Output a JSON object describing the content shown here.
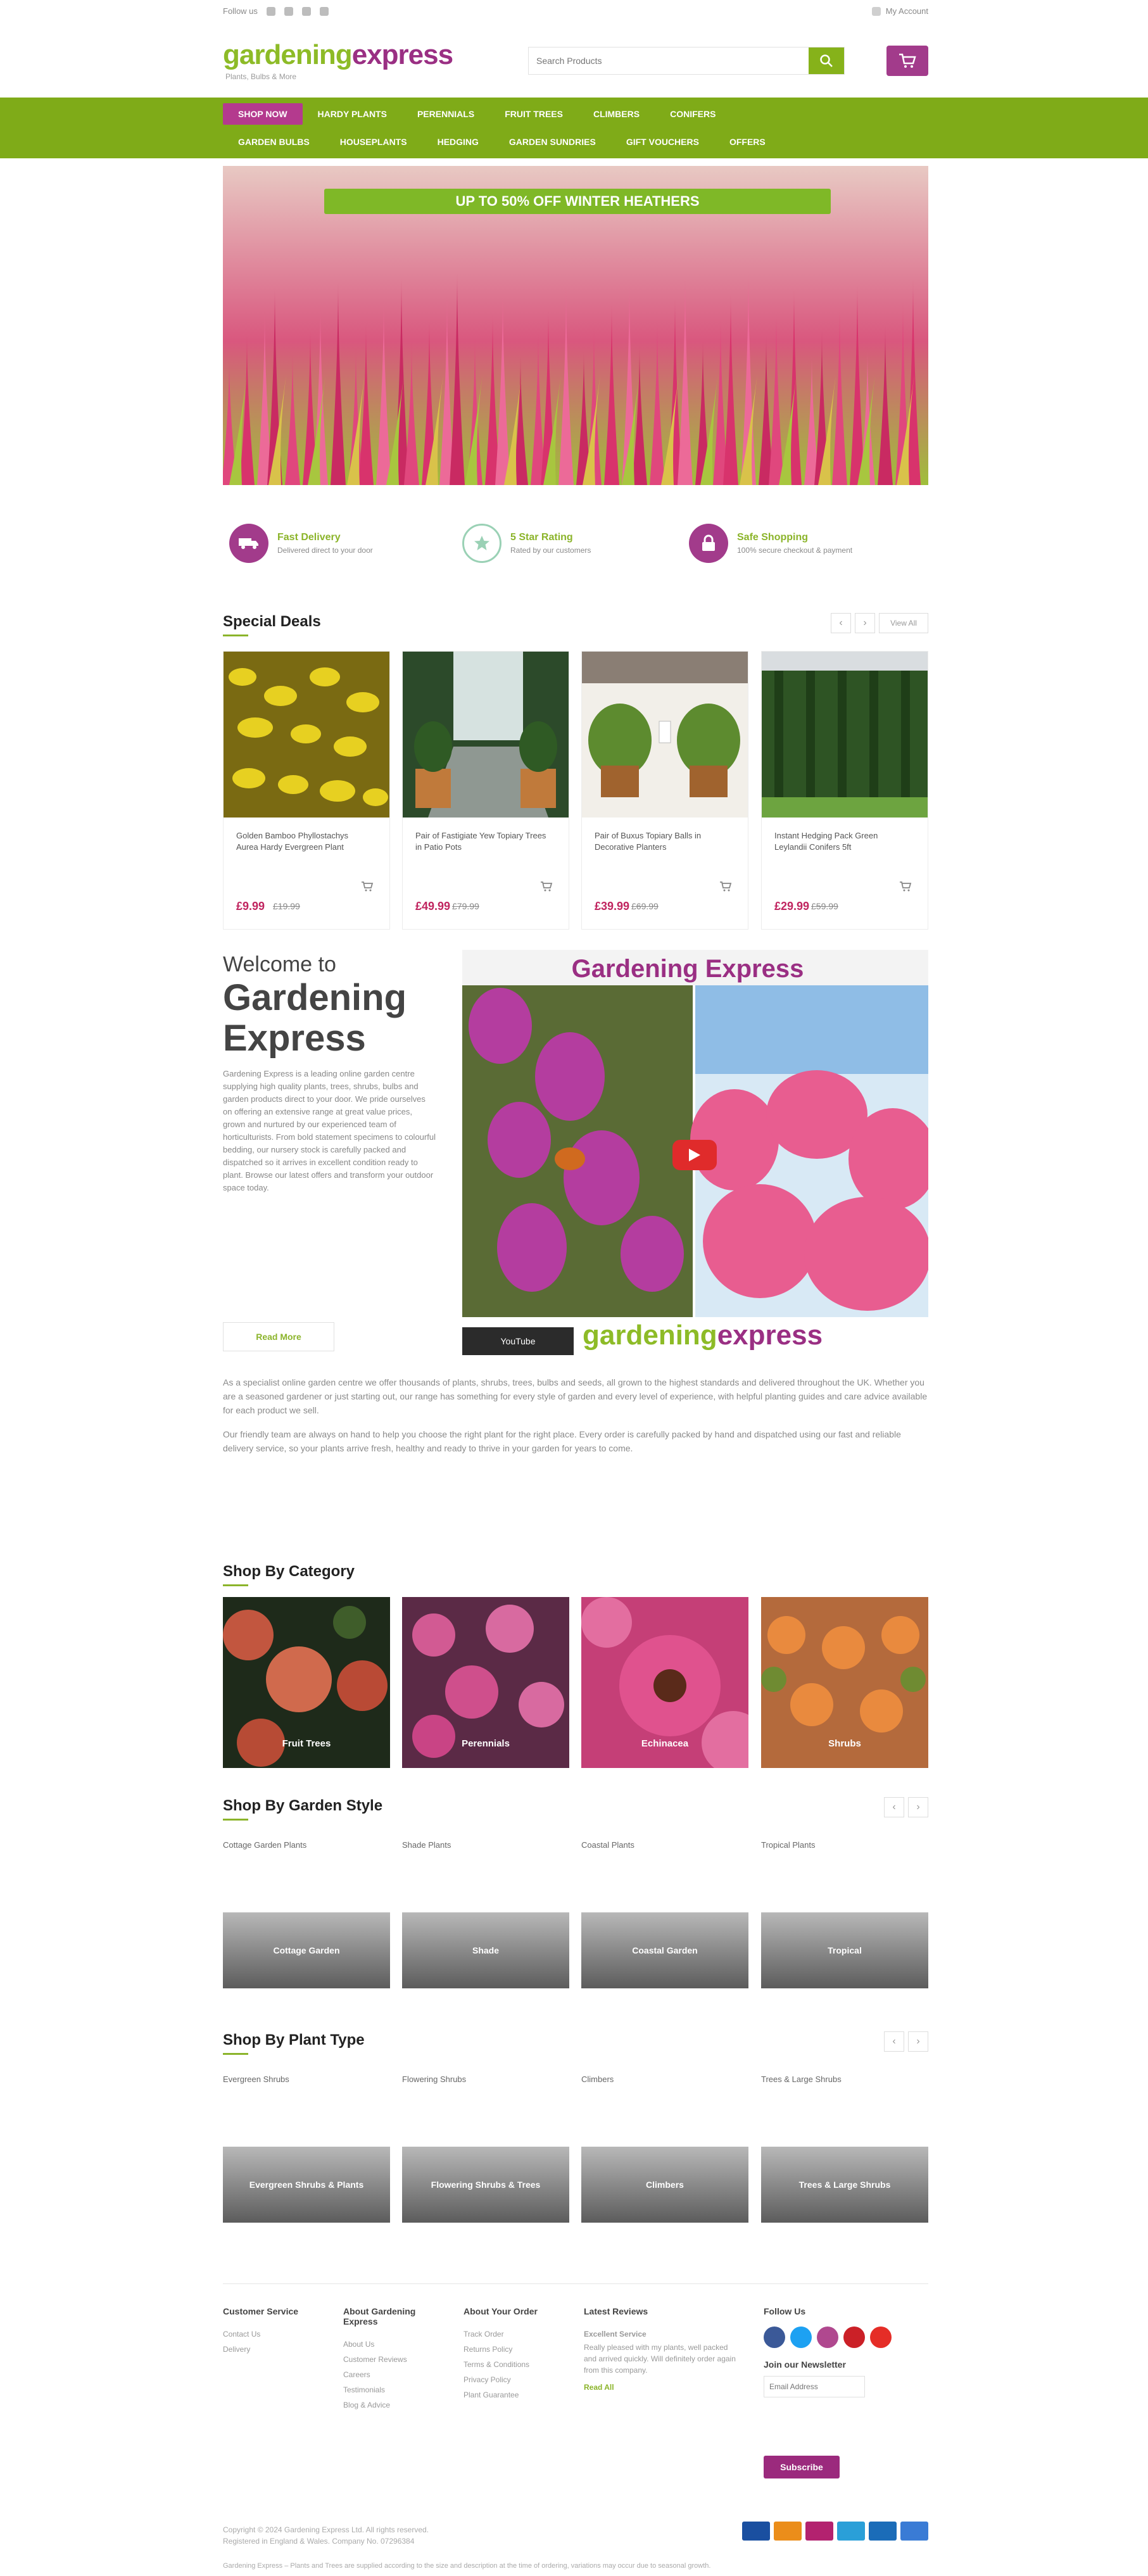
{
  "topbar": {
    "follow_label": "Follow us",
    "social": [
      "facebook-icon",
      "twitter-icon",
      "pinterest-icon",
      "instagram-icon"
    ],
    "account_label": "My Account"
  },
  "header": {
    "logo_green": "gardening",
    "logo_purple": "express",
    "logo_tagline": "Plants, Bulbs & More",
    "search_placeholder": "Search Products",
    "search_icon": "search-icon",
    "cart_icon": "cart-icon"
  },
  "nav": {
    "row1": [
      "Shop Now",
      "Hardy Plants",
      "Perennials",
      "Fruit Trees",
      "Climbers",
      "Conifers"
    ],
    "row2": [
      "Garden Bulbs",
      "Houseplants",
      "Hedging",
      "Garden Sundries",
      "Gift Vouchers",
      "Offers"
    ]
  },
  "hero": {
    "banner": "UP TO 50% OFF WINTER HEATHERS"
  },
  "usps": [
    {
      "title": "Fast Delivery",
      "sub": "Delivered direct to your door"
    },
    {
      "title": "5 Star Rating",
      "sub": "Rated by our customers"
    },
    {
      "title": "Safe Shopping",
      "sub": "100% secure checkout & payment"
    }
  ],
  "deals": {
    "title": "Special Deals",
    "view_all": "View All",
    "products": [
      {
        "name": "Golden Bamboo Phyllostachys Aurea Hardy Evergreen Plant",
        "price": "£9.99",
        "was": "£19.99"
      },
      {
        "name": "Pair of Fastigiate Yew Topiary Trees in Patio Pots",
        "price": "£49.99",
        "was": "£79.99"
      },
      {
        "name": "Pair of Buxus Topiary Balls in Decorative Planters",
        "price": "£39.99",
        "was": "£69.99"
      },
      {
        "name": "Instant Hedging Pack Green Leylandii Conifers 5ft",
        "price": "£29.99",
        "was": "£59.99"
      }
    ]
  },
  "welcome": {
    "small": "Welcome to",
    "big": "Gardening Express",
    "para": "Gardening Express is a leading online garden centre supplying high quality plants, trees, shrubs, bulbs and garden products direct to your door. We pride ourselves on offering an extensive range at great value prices, grown and nurtured by our experienced team of horticulturists. From bold statement specimens to colourful bedding, our nursery stock is carefully packed and dispatched so it arrives in excellent condition ready to plant. Browse our latest offers and transform your outdoor space today.",
    "read_more": "Read More",
    "video_title": "Gardening Express",
    "yt_label": "YouTube",
    "video_logo_green": "gardening",
    "video_logo_purple": "express"
  },
  "intro": [
    "As a specialist online garden centre we offer thousands of plants, shrubs, trees, bulbs and seeds, all grown to the highest standards and delivered throughout the UK. Whether you are a seasoned gardener or just starting out, our range has something for every style of garden and every level of experience, with helpful planting guides and care advice available for each product we sell.",
    "Our friendly team are always on hand to help you choose the right plant for the right place. Every order is carefully packed by hand and dispatched using our fast and reliable delivery service, so your plants arrive fresh, healthy and ready to thrive in your garden for years to come."
  ],
  "categories": {
    "title": "Shop By Category",
    "items": [
      "Fruit Trees",
      "Perennials",
      "Echinacea",
      "Shrubs"
    ]
  },
  "garden_style": {
    "title": "Shop By Garden Style",
    "items": [
      {
        "caption": "Cottage Garden Plants",
        "button": "Cottage Garden"
      },
      {
        "caption": "Shade Plants",
        "button": "Shade"
      },
      {
        "caption": "Coastal Plants",
        "button": "Coastal Garden"
      },
      {
        "caption": "Tropical Plants",
        "button": "Tropical"
      }
    ]
  },
  "plant_type": {
    "title": "Shop By Plant Type",
    "items": [
      {
        "caption": "Evergreen Shrubs",
        "button": "Evergreen Shrubs & Plants"
      },
      {
        "caption": "Flowering Shrubs",
        "button": "Flowering Shrubs & Trees"
      },
      {
        "caption": "Climbers",
        "button": "Climbers"
      },
      {
        "caption": "Trees & Large Shrubs",
        "button": "Trees & Large Shrubs"
      }
    ]
  },
  "footer": {
    "col1": {
      "title": "Customer Service",
      "links": [
        "Contact Us",
        "Delivery"
      ]
    },
    "col2": {
      "title": "About Gardening Express",
      "links": [
        "About Us",
        "Customer Reviews",
        "Careers",
        "Testimonials",
        "Blog & Advice"
      ]
    },
    "col3": {
      "title": "About Your Order",
      "links": [
        "Track Order",
        "Returns Policy",
        "Terms & Conditions",
        "Privacy Policy",
        "Plant Guarantee"
      ]
    },
    "col4": {
      "title": "Latest Reviews",
      "links": [
        "Excellent Service",
        "Really pleased with my plants, well packed and arrived quickly. Will definitely order again from this company."
      ],
      "more": "Read All"
    },
    "col5": {
      "title": "Follow Us",
      "newsletter": "Join our Newsletter",
      "email_placeholder": "Email Address",
      "subscribe": "Subscribe"
    },
    "copyright": "Copyright © 2024 Gardening Express Ltd. All rights reserved.",
    "company": "Registered in England & Wales. Company No. 07296384",
    "disclaimer": "Gardening Express – Plants and Trees are supplied according to the size and description at the time of ordering, variations may occur due to seasonal growth."
  },
  "colors": {
    "brand_green": "#7fab18",
    "brand_purple": "#a23b8b",
    "price_red": "#c0245f"
  }
}
